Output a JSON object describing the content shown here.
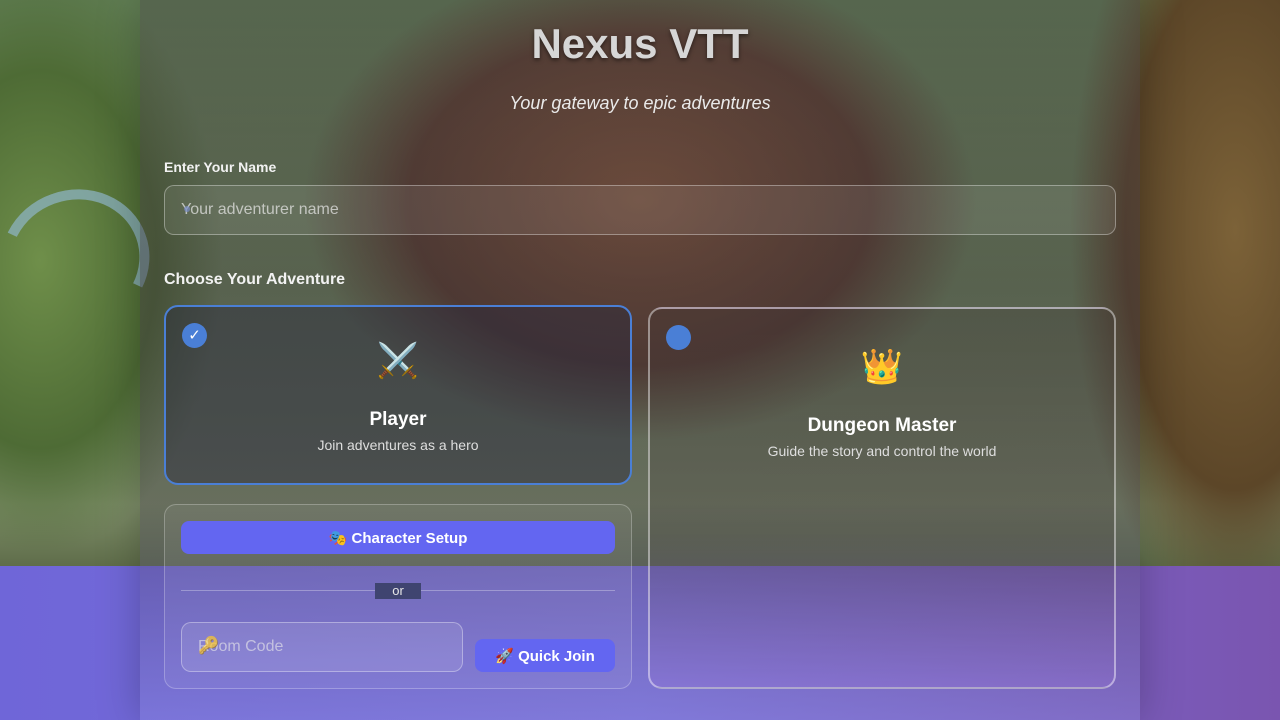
{
  "app": {
    "title": "Nexus VTT",
    "subtitle": "Your gateway to epic adventures"
  },
  "name_field": {
    "label": "Enter Your Name",
    "placeholder": "Your adventurer name",
    "value": ""
  },
  "adventure": {
    "label": "Choose Your Adventure",
    "selected": "player",
    "options": [
      {
        "id": "player",
        "emoji": "⚔️",
        "title": "Player",
        "description": "Join adventures as a hero",
        "checked_mark": "✓"
      },
      {
        "id": "dm",
        "emoji": "👑",
        "title": "Dungeon Master",
        "description": "Guide the story and control the world"
      }
    ]
  },
  "player_panel": {
    "setup_button": {
      "emoji": "🎭",
      "label": "Character Setup"
    },
    "divider_text": "or",
    "room_code": {
      "placeholder": "Room Code",
      "value": "",
      "icon": "🔑"
    },
    "join_button": {
      "emoji": "🚀",
      "label": "Quick Join"
    }
  },
  "colors": {
    "accent": "#6366f1",
    "selection": "#4a7fd6"
  }
}
